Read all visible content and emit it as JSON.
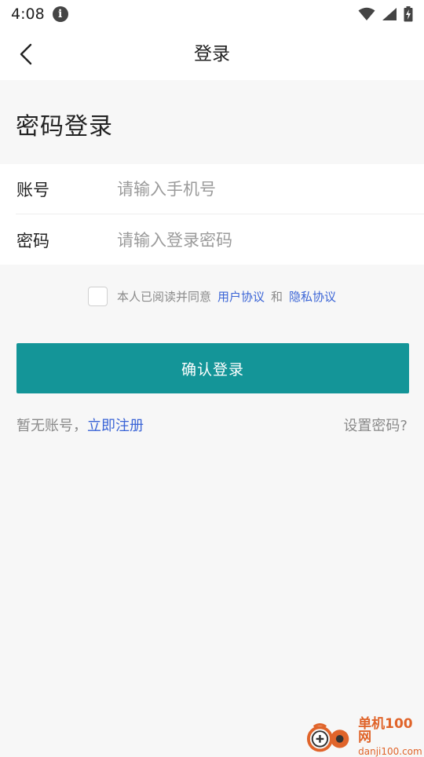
{
  "status_bar": {
    "time": "4:08",
    "info_glyph": "i"
  },
  "nav": {
    "back_icon": "chevron-left-icon",
    "title": "登录"
  },
  "section": {
    "title": "密码登录"
  },
  "form": {
    "account_label": "账号",
    "account_placeholder": "请输入手机号",
    "account_value": "",
    "password_label": "密码",
    "password_placeholder": "请输入登录密码",
    "password_value": ""
  },
  "agreement": {
    "checked": false,
    "prefix": "本人已阅读并同意",
    "user_agreement": "用户协议",
    "and": "和",
    "privacy_agreement": "隐私协议"
  },
  "login_button": "确认登录",
  "footer": {
    "no_account": "暂无账号，",
    "register": "立即注册",
    "set_password": "设置密码?"
  },
  "watermark": {
    "brand": "单机100网",
    "url": "danji100.com"
  },
  "colors": {
    "accent": "#149598",
    "link": "#3a64d6",
    "background": "#f7f7f7",
    "watermark": "#e0642a"
  }
}
